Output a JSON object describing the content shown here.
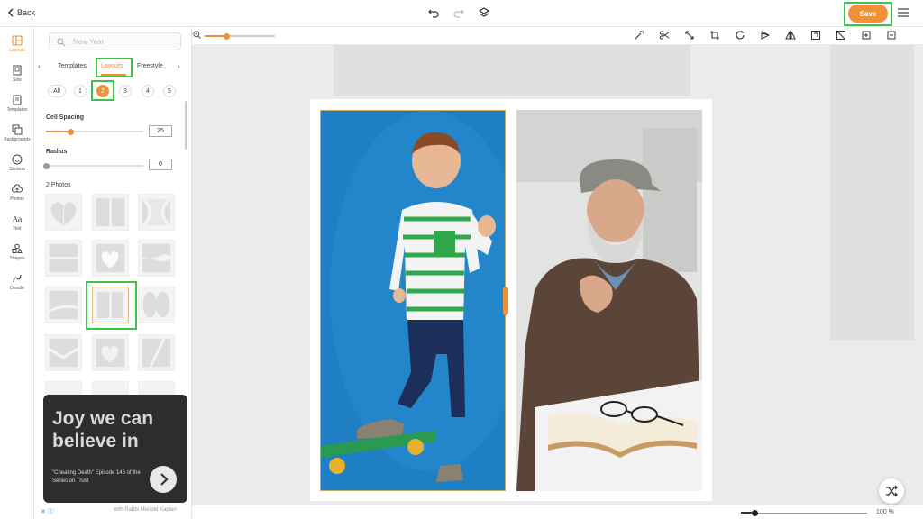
{
  "header": {
    "back_label": "Back",
    "save_label": "Save"
  },
  "nav": [
    {
      "label": "Layouts",
      "icon": "layouts-icon",
      "active": true
    },
    {
      "label": "Size",
      "icon": "size-icon"
    },
    {
      "label": "Templates",
      "icon": "templates-icon"
    },
    {
      "label": "Backgrounds",
      "icon": "backgrounds-icon"
    },
    {
      "label": "Stickers",
      "icon": "stickers-icon"
    },
    {
      "label": "Photos",
      "icon": "photos-icon"
    },
    {
      "label": "Text",
      "icon": "text-icon"
    },
    {
      "label": "Shapes",
      "icon": "shapes-icon"
    },
    {
      "label": "Doodle",
      "icon": "doodle-icon"
    }
  ],
  "panel": {
    "search_placeholder": "New Year",
    "tabs": [
      "Templates",
      "Layouts",
      "Freestyle"
    ],
    "active_tab": "Layouts",
    "counts": [
      "All",
      "1",
      "2",
      "3",
      "4",
      "5"
    ],
    "selected_count": "2",
    "cell_spacing_label": "Cell Spacing",
    "cell_spacing_value": "25",
    "cell_spacing_fraction": 0.25,
    "radius_label": "Radius",
    "radius_value": "0",
    "radius_fraction": 0,
    "section_title": "2 Photos"
  },
  "ad": {
    "headline": "Joy we can believe in",
    "subtext": "\"Cheating Death\" Episode 145 of the Series on Trust",
    "footer": "with Rabbi Mendel Kaplan"
  },
  "footer": {
    "zoom_label": "100 %"
  },
  "colors": {
    "accent": "#f0913a",
    "highlight": "#3cc34a",
    "photo_bg": "#1f7fc4"
  }
}
